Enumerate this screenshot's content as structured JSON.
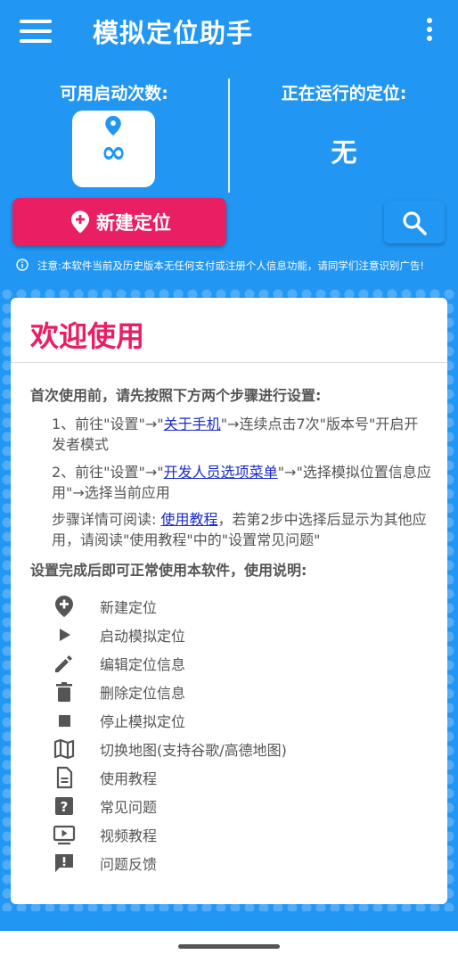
{
  "app": {
    "title": "模拟定位助手"
  },
  "stats": {
    "available_label": "可用启动次数:",
    "available_value": "∞",
    "running_label": "正在运行的定位:",
    "running_value": "无"
  },
  "actions": {
    "new_location": "新建定位"
  },
  "notice": "注意:本软件当前及历史版本无任何支付或注册个人信息功能，请同学们注意识别广告!",
  "card": {
    "title": "欢迎使用",
    "intro": "首次使用前，请先按照下方两个步骤进行设置:",
    "step1_a": "1、前往\"设置\"→\"",
    "step1_link": "关于手机",
    "step1_b": "\"→连续点击7次\"版本号\"开启开发者模式",
    "step2_a": "2、前往\"设置\"→\"",
    "step2_link": "开发人员选项菜单",
    "step2_b": "\"→\"选择模拟位置信息应用\"→选择当前应用",
    "detail_a": "步骤详情可阅读: ",
    "detail_link": "使用教程",
    "detail_b": "，若第2步中选择后显示为其他应用，请阅读\"使用教程\"中的\"设置常见问题\"",
    "usage_title": "设置完成后即可正常使用本软件，使用说明:",
    "help_items": [
      {
        "icon": "add-location-icon",
        "label": "新建定位"
      },
      {
        "icon": "play-icon",
        "label": "启动模拟定位"
      },
      {
        "icon": "pencil-icon",
        "label": "编辑定位信息"
      },
      {
        "icon": "trash-icon",
        "label": "删除定位信息"
      },
      {
        "icon": "stop-icon",
        "label": "停止模拟定位"
      },
      {
        "icon": "map-icon",
        "label": "切换地图(支持谷歌/高德地图)"
      },
      {
        "icon": "document-icon",
        "label": "使用教程"
      },
      {
        "icon": "question-icon",
        "label": "常见问题"
      },
      {
        "icon": "video-icon",
        "label": "视频教程"
      },
      {
        "icon": "feedback-icon",
        "label": "问题反馈"
      }
    ]
  },
  "colors": {
    "primary": "#2196F3",
    "accent": "#E91E63",
    "link": "#1A2CC7"
  }
}
